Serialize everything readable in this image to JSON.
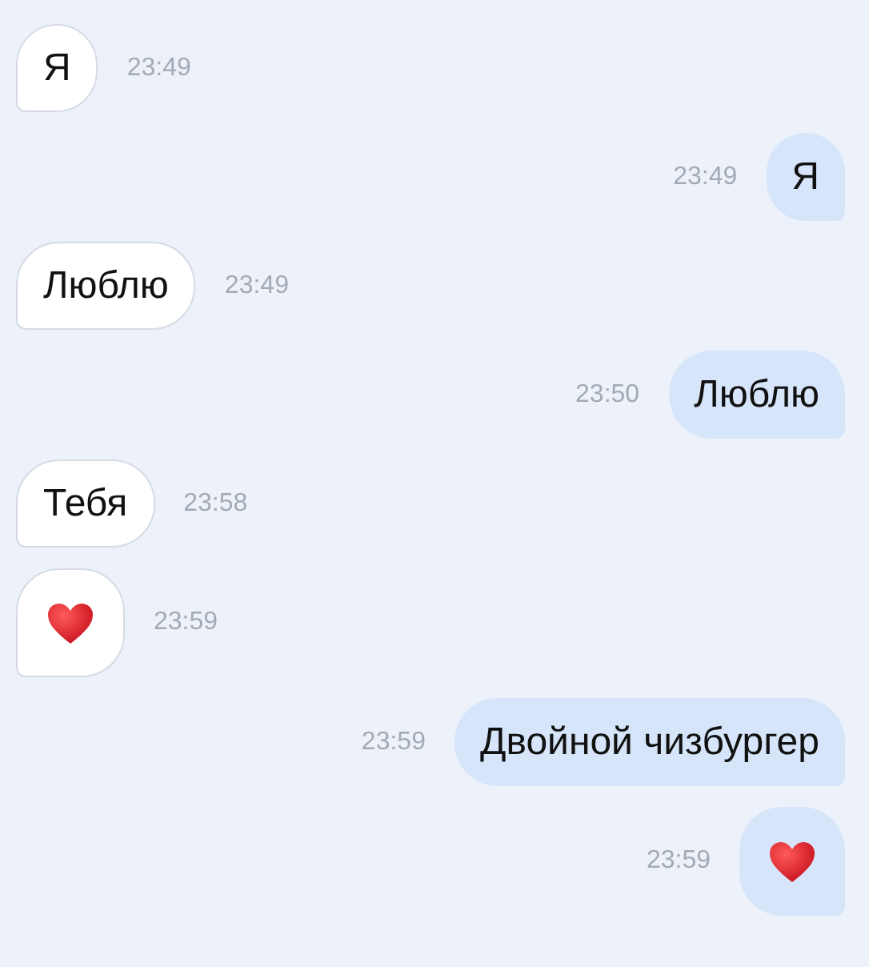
{
  "messages": [
    {
      "outgoing": false,
      "kind": "text",
      "text": "Я",
      "time": "23:49"
    },
    {
      "outgoing": true,
      "kind": "text",
      "text": "Я",
      "time": "23:49"
    },
    {
      "outgoing": false,
      "kind": "text",
      "text": "Люблю",
      "time": "23:49"
    },
    {
      "outgoing": true,
      "kind": "text",
      "text": "Люблю",
      "time": "23:50"
    },
    {
      "outgoing": false,
      "kind": "text",
      "text": "Тебя",
      "time": "23:58"
    },
    {
      "outgoing": false,
      "kind": "heart",
      "time": "23:59"
    },
    {
      "outgoing": true,
      "kind": "text",
      "text": "Двойной чизбургер",
      "time": "23:59"
    },
    {
      "outgoing": true,
      "kind": "heart",
      "time": "23:59"
    }
  ]
}
